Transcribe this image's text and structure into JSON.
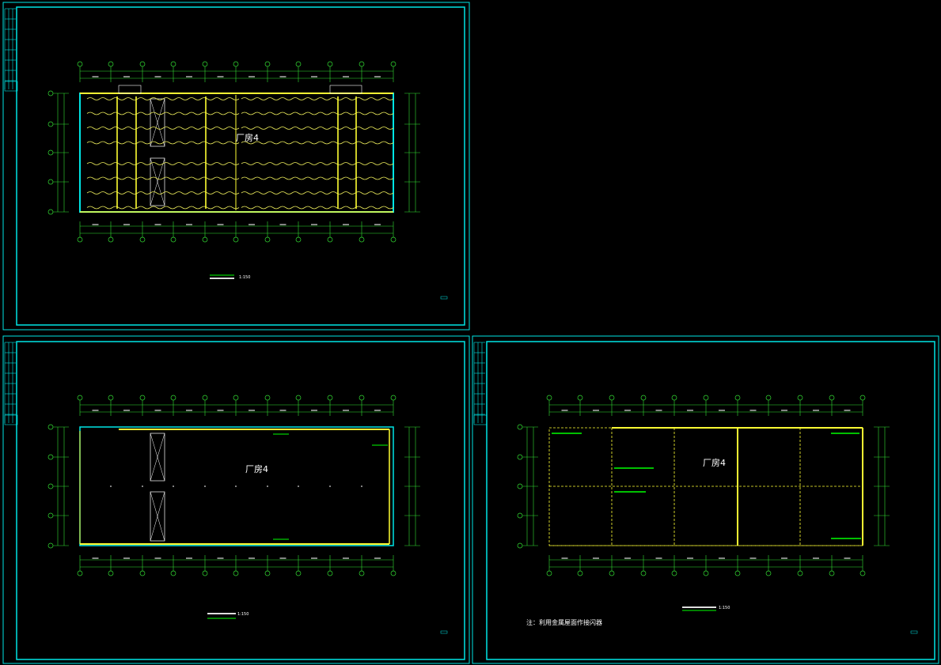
{
  "colors": {
    "background": "#000000",
    "frame": "#00e5e5",
    "dimension": "#33dd33",
    "axis_bubble": "#33dd33",
    "wall": "#ffff33",
    "wiring": "#e8e85a",
    "label_green": "#00ff00",
    "text_white": "#ffffff"
  },
  "sheets": [
    {
      "id": "sheet-top-left",
      "building_label": "厂房4",
      "title": "",
      "scale": "1:150",
      "content": "lighting-plan"
    },
    {
      "id": "sheet-bottom-left",
      "building_label": "厂房4",
      "title": "",
      "scale": "1:150",
      "content": "power-plan"
    },
    {
      "id": "sheet-bottom-right",
      "building_label": "厂房4",
      "title": "",
      "scale": "1:150",
      "content": "roof-lightning-plan",
      "note": "注：利用金属屋面作接闪器"
    }
  ]
}
